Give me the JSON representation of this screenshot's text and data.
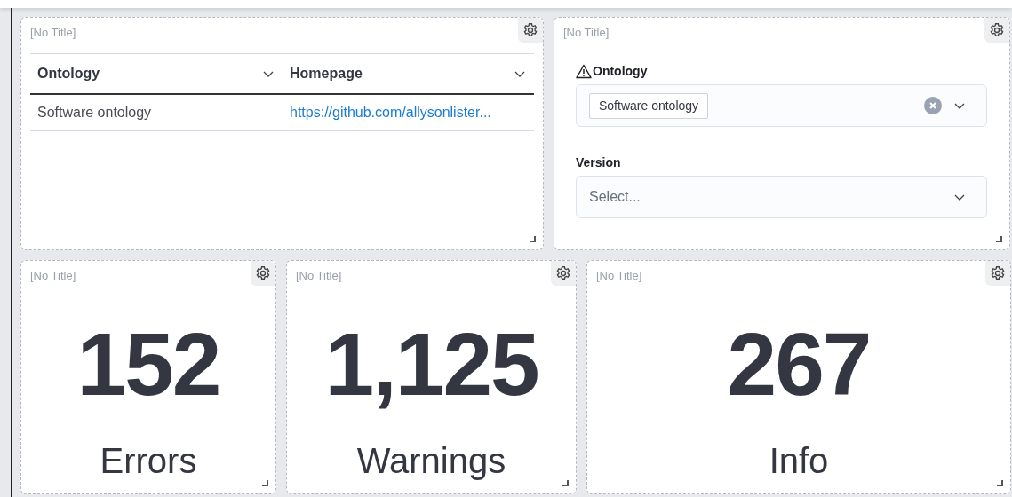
{
  "top_row": [
    {
      "kind": "table",
      "title": "[No Title]",
      "columns": [
        "Ontology",
        "Homepage"
      ],
      "rows": [
        {
          "cells": [
            {
              "text": "Software ontology",
              "kind": "text"
            },
            {
              "text": "https://github.com/allysonlister...",
              "kind": "link"
            }
          ]
        }
      ]
    },
    {
      "kind": "form",
      "title": "[No Title]",
      "fields": [
        {
          "label": "Ontology",
          "warning": true,
          "tags": [
            "Software ontology"
          ],
          "clearable": true
        },
        {
          "label": "Version",
          "warning": false,
          "placeholder": "Select..."
        }
      ]
    }
  ],
  "bottom_row": [
    {
      "kind": "stat",
      "title": "[No Title]",
      "value": "152",
      "label": "Errors"
    },
    {
      "kind": "stat",
      "title": "[No Title]",
      "value": "1,125",
      "label": "Warnings"
    },
    {
      "kind": "stat",
      "title": "[No Title]",
      "value": "267",
      "label": "Info"
    }
  ]
}
